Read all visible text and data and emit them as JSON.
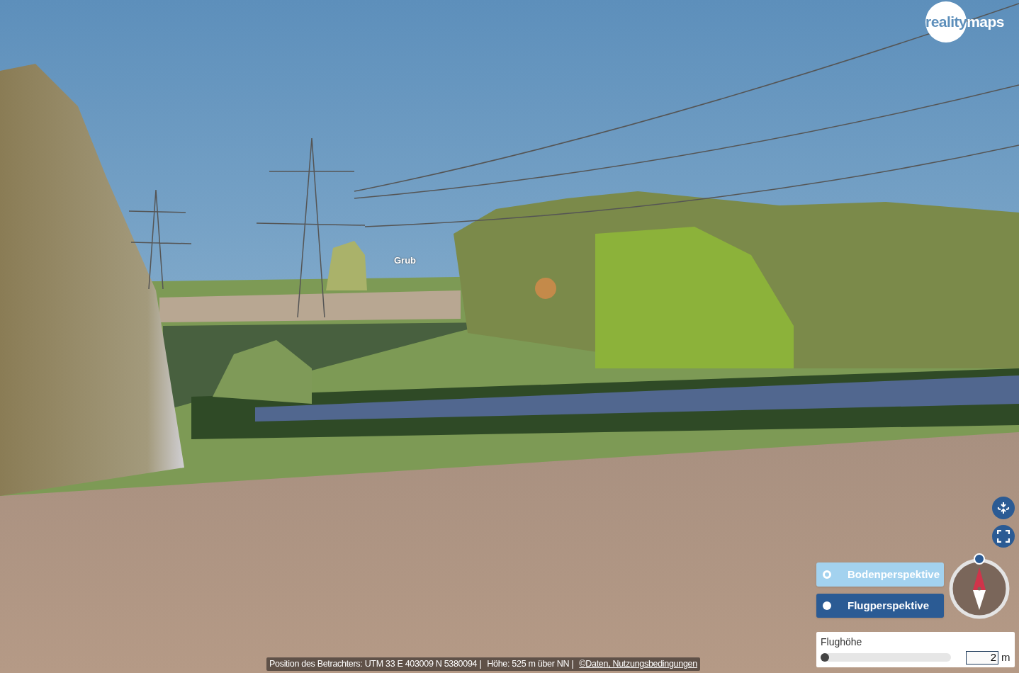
{
  "logo": {
    "part_1": "reality",
    "part_2": "maps"
  },
  "map_labels": [
    {
      "text": "Grub"
    }
  ],
  "perspectives": [
    {
      "label": "Bodenperspektive",
      "selected": false
    },
    {
      "label": "Flugperspektive",
      "selected": true
    }
  ],
  "altitude": {
    "label": "Flughöhe",
    "level": 0,
    "value": "2",
    "unit": "m"
  },
  "status_bar": {
    "position": "Position des Betrachters: UTM 33 E 403009 N 5380094 |",
    "height": "Höhe: 525 m über NN |",
    "link": "©Daten, Nutzungsbedingungen"
  }
}
